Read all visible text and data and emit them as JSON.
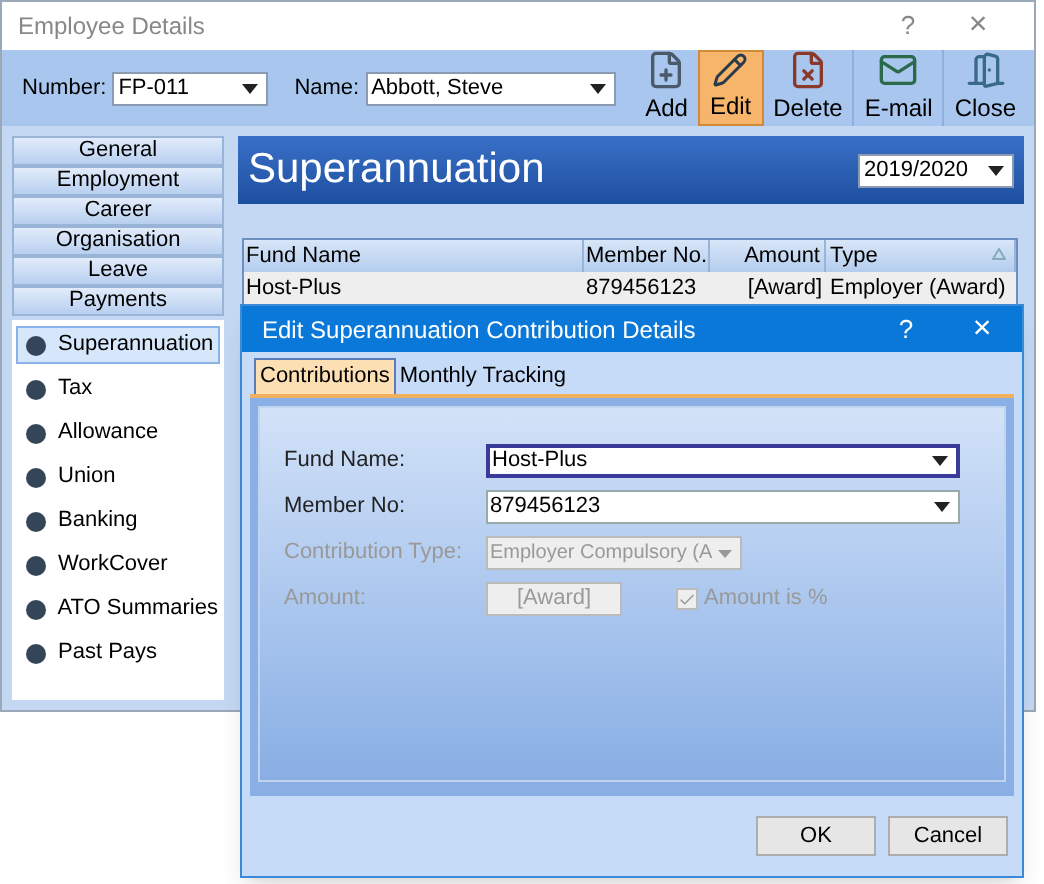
{
  "window": {
    "title": "Employee Details",
    "help": "?",
    "close": "×"
  },
  "toolbar": {
    "number_label": "Number:",
    "number_value": "FP-011",
    "name_label": "Name:",
    "name_value": "Abbott, Steve",
    "buttons": [
      {
        "label": "Add",
        "kind": "add",
        "selected": false
      },
      {
        "label": "Edit",
        "kind": "edit",
        "selected": true
      },
      {
        "label": "Delete",
        "kind": "delete",
        "selected": false
      },
      {
        "label": "E-mail",
        "kind": "email",
        "selected": false
      },
      {
        "label": "Close",
        "kind": "close",
        "selected": false
      }
    ]
  },
  "sidebar": {
    "groups": [
      "General",
      "Employment",
      "Career",
      "Organisation",
      "Leave",
      "Payments"
    ],
    "items": [
      {
        "label": "Superannuation",
        "selected": true
      },
      {
        "label": "Tax",
        "selected": false
      },
      {
        "label": "Allowance",
        "selected": false
      },
      {
        "label": "Union",
        "selected": false
      },
      {
        "label": "Banking",
        "selected": false
      },
      {
        "label": "WorkCover",
        "selected": false
      },
      {
        "label": "ATO Summaries",
        "selected": false
      },
      {
        "label": "Past Pays",
        "selected": false
      }
    ]
  },
  "panel": {
    "title": "Superannuation",
    "year": "2019/2020"
  },
  "table": {
    "columns": [
      "Fund Name",
      "Member No.",
      "Amount",
      "Type"
    ],
    "rows": [
      [
        "Host-Plus",
        "879456123",
        "[Award]",
        "Employer (Award)"
      ]
    ]
  },
  "dialog": {
    "title": "Edit Superannuation Contribution Details",
    "help": "?",
    "close": "×",
    "tabs": [
      {
        "label": "Contributions",
        "selected": true
      },
      {
        "label": "Monthly Tracking",
        "selected": false
      }
    ],
    "fields": [
      {
        "label": "Fund Name:",
        "value": "Host-Plus",
        "kind": "dropdown",
        "disabled": false,
        "focused": true
      },
      {
        "label": "Member No:",
        "value": "879456123",
        "kind": "dropdown",
        "disabled": false,
        "focused": false
      },
      {
        "label": "Contribution Type:",
        "value": "Employer Compulsory (A",
        "kind": "select",
        "disabled": true,
        "focused": false
      },
      {
        "label": "Amount:",
        "value": "[Award]",
        "kind": "amount",
        "disabled": true,
        "focused": false,
        "checkbox": {
          "label": "Amount is %",
          "checked": true,
          "disabled": true
        }
      }
    ],
    "buttons": [
      "OK",
      "Cancel"
    ]
  }
}
